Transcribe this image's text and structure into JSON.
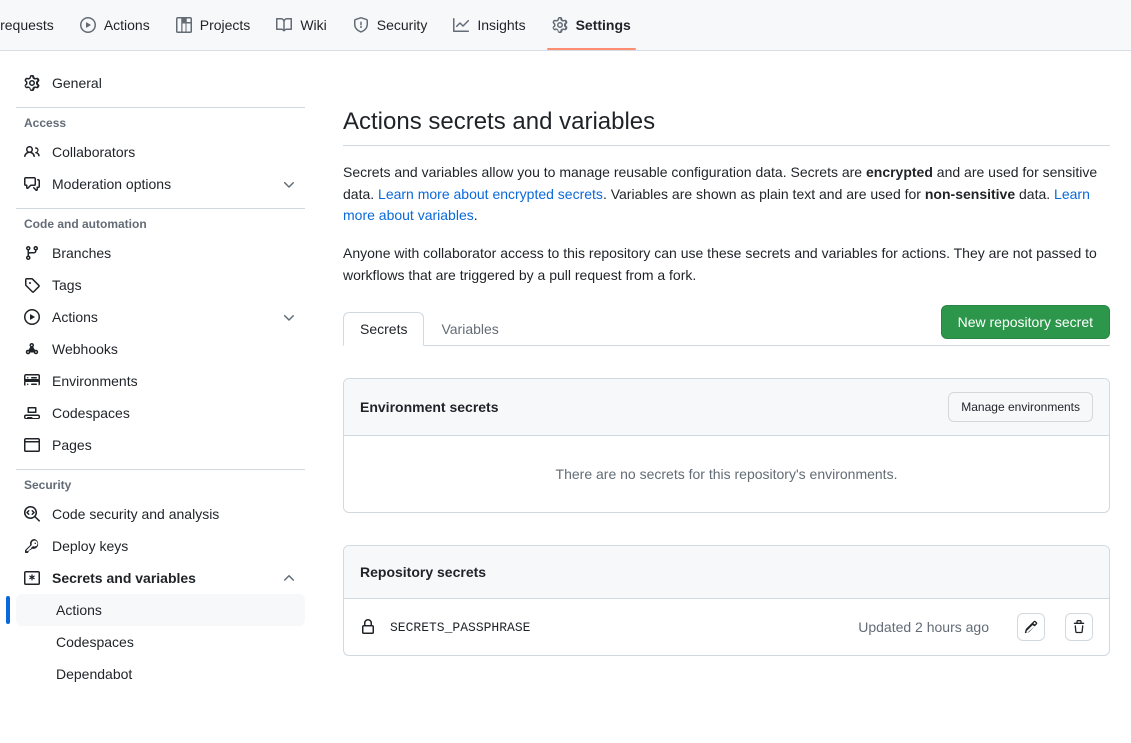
{
  "topnav": {
    "items": [
      {
        "label": "ll requests",
        "icon": "pull-request-icon",
        "active": false,
        "truncated": true
      },
      {
        "label": "Actions",
        "icon": "play-circle-icon",
        "active": false
      },
      {
        "label": "Projects",
        "icon": "table-icon",
        "active": false
      },
      {
        "label": "Wiki",
        "icon": "book-icon",
        "active": false
      },
      {
        "label": "Security",
        "icon": "shield-icon",
        "active": false
      },
      {
        "label": "Insights",
        "icon": "graph-icon",
        "active": false
      },
      {
        "label": "Settings",
        "icon": "gear-icon",
        "active": true
      }
    ]
  },
  "sidebar": {
    "general": {
      "label": "General",
      "icon": "gear-icon"
    },
    "sections": [
      {
        "heading": "Access",
        "items": [
          {
            "label": "Collaborators",
            "icon": "people-icon",
            "expandable": false
          },
          {
            "label": "Moderation options",
            "icon": "comment-discussion-icon",
            "expandable": true,
            "expanded": false
          }
        ]
      },
      {
        "heading": "Code and automation",
        "items": [
          {
            "label": "Branches",
            "icon": "git-branch-icon",
            "expandable": false
          },
          {
            "label": "Tags",
            "icon": "tag-icon",
            "expandable": false
          },
          {
            "label": "Actions",
            "icon": "play-circle-icon",
            "expandable": true,
            "expanded": false
          },
          {
            "label": "Webhooks",
            "icon": "webhook-icon",
            "expandable": false
          },
          {
            "label": "Environments",
            "icon": "server-icon",
            "expandable": false
          },
          {
            "label": "Codespaces",
            "icon": "codespaces-icon",
            "expandable": false
          },
          {
            "label": "Pages",
            "icon": "browser-icon",
            "expandable": false
          }
        ]
      },
      {
        "heading": "Security",
        "items": [
          {
            "label": "Code security and analysis",
            "icon": "codescan-icon",
            "expandable": false
          },
          {
            "label": "Deploy keys",
            "icon": "key-icon",
            "expandable": false
          },
          {
            "label": "Secrets and variables",
            "icon": "asterisk-box-icon",
            "expandable": true,
            "expanded": true,
            "bold": true
          }
        ],
        "subitems": [
          {
            "label": "Actions",
            "selected": true
          },
          {
            "label": "Codespaces",
            "selected": false
          },
          {
            "label": "Dependabot",
            "selected": false
          }
        ]
      }
    ],
    "accent_selected": "#0969da",
    "selected_bg": "#f6f8fa"
  },
  "main": {
    "title": "Actions secrets and variables",
    "paragraph1": {
      "part1": "Secrets and variables allow you to manage reusable configuration data. Secrets are ",
      "bold1": "encrypted",
      "part2": " and are used for sensitive data. ",
      "link1": "Learn more about encrypted secrets",
      "part3": ". Variables are shown as plain text and are used for ",
      "bold2": "non-sensitive",
      "part4": " data. ",
      "link2": "Learn more about variables",
      "part5": "."
    },
    "paragraph2": "Anyone with collaborator access to this repository can use these secrets and variables for actions. They are not passed to workflows that are triggered by a pull request from a fork.",
    "tabs": [
      {
        "label": "Secrets",
        "active": true
      },
      {
        "label": "Variables",
        "active": false
      }
    ],
    "new_secret_button": "New repository secret",
    "new_secret_color": "#2c974b",
    "environment_card": {
      "title": "Environment secrets",
      "manage_button": "Manage environments",
      "empty_text": "There are no secrets for this repository's environments."
    },
    "repository_card": {
      "title": "Repository secrets",
      "secrets": [
        {
          "name": "SECRETS_PASSPHRASE",
          "icon": "lock-icon",
          "updated": "Updated 2 hours ago",
          "edit_icon": "pencil-icon",
          "delete_icon": "trash-icon"
        }
      ]
    }
  }
}
